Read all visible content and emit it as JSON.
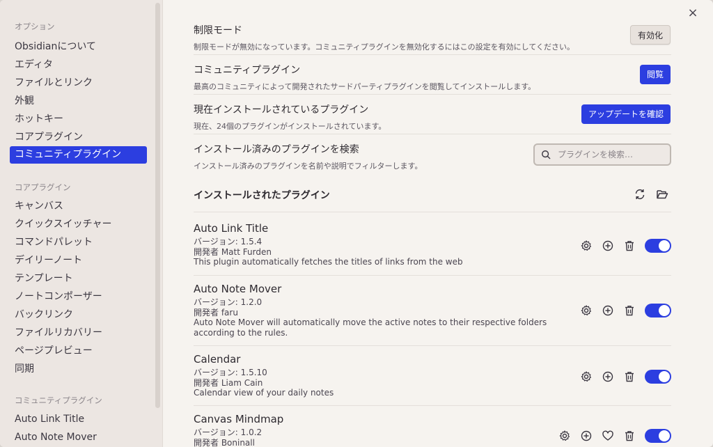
{
  "sidebar": {
    "groups": [
      {
        "title": "オプション",
        "items": [
          "Obsidianについて",
          "エディタ",
          "ファイルとリンク",
          "外観",
          "ホットキー",
          "コアプラグイン",
          "コミュニティプラグイン"
        ]
      },
      {
        "title": "コアプラグイン",
        "items": [
          "キャンバス",
          "クイックスイッチャー",
          "コマンドパレット",
          "デイリーノート",
          "テンプレート",
          "ノートコンポーザー",
          "バックリンク",
          "ファイルリカバリー",
          "ページプレビュー",
          "同期"
        ]
      },
      {
        "title": "コミュニティプラグイン",
        "items": [
          "Auto Link Title",
          "Auto Note Mover"
        ]
      }
    ],
    "active_item": "コミュニティプラグイン"
  },
  "close_label": "×",
  "settings": {
    "restricted": {
      "name": "制限モード",
      "desc": "制限モードが無効になっています。コミュニティプラグインを無効化するにはこの設定を有効にしてください。",
      "button": "有効化"
    },
    "community": {
      "name": "コミュニティプラグイン",
      "desc": "最高のコミュニティによって開発されたサードパーティプラグインを閲覧してインストールします。",
      "button": "閲覧"
    },
    "installed": {
      "name": "現在インストールされているプラグイン",
      "desc": "現在、24個のプラグインがインストールされています。",
      "button": "アップデートを確認"
    },
    "search": {
      "name": "インストール済みのプラグインを検索",
      "desc": "インストール済みのプラグインを名前や説明でフィルターします。",
      "placeholder": "プラグインを検索…"
    }
  },
  "installed_heading": "インストールされたプラグイン",
  "plugins": [
    {
      "name": "Auto Link Title",
      "version": "バージョン: 1.5.4",
      "author": "開発者 Matt Furden",
      "desc": "This plugin automatically fetches the titles of links from the web",
      "enabled": true
    },
    {
      "name": "Auto Note Mover",
      "version": "バージョン: 1.2.0",
      "author": "開発者 faru",
      "desc": "Auto Note Mover will automatically move the active notes to their respective folders according to the rules.",
      "enabled": true
    },
    {
      "name": "Calendar",
      "version": "バージョン: 1.5.10",
      "author": "開発者 Liam Cain",
      "desc": "Calendar view of your daily notes",
      "enabled": true
    },
    {
      "name": "Canvas Mindmap",
      "version": "バージョン: 1.0.2",
      "author": "開発者 Boninall",
      "desc": "",
      "enabled": true
    }
  ],
  "colors": {
    "accent": "#2c3ee0",
    "sidebar_bg": "#ece6e2",
    "main_bg": "#f6f3ef"
  }
}
